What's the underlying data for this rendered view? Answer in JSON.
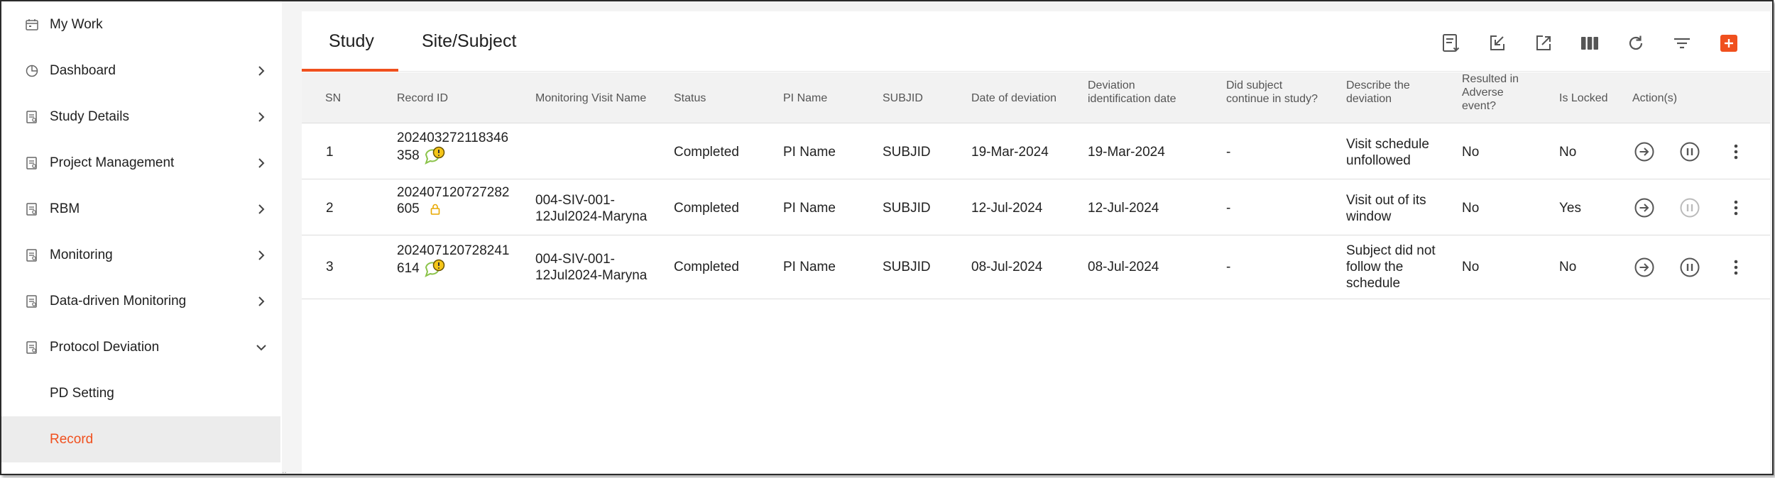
{
  "sidebar": {
    "items": [
      {
        "label": "My Work",
        "icon": "calendar-icon",
        "chevron": "none"
      },
      {
        "label": "Dashboard",
        "icon": "pie-chart-icon",
        "chevron": "right"
      },
      {
        "label": "Study Details",
        "icon": "document-icon",
        "chevron": "right"
      },
      {
        "label": "Project Management",
        "icon": "document-icon",
        "chevron": "right"
      },
      {
        "label": "RBM",
        "icon": "document-icon",
        "chevron": "right"
      },
      {
        "label": "Monitoring",
        "icon": "document-icon",
        "chevron": "right"
      },
      {
        "label": "Data-driven Monitoring",
        "icon": "document-icon",
        "chevron": "right"
      },
      {
        "label": "Protocol Deviation",
        "icon": "document-icon",
        "chevron": "down"
      }
    ],
    "subitems": [
      {
        "label": "PD Setting",
        "active": false
      },
      {
        "label": "Record",
        "active": true
      }
    ]
  },
  "tabs": [
    {
      "label": "Study",
      "active": true
    },
    {
      "label": "Site/Subject",
      "active": false
    }
  ],
  "toolbar": {
    "icons": [
      "export-report-icon",
      "import-icon",
      "open-external-icon",
      "columns-icon",
      "refresh-icon",
      "filter-icon",
      "add-icon"
    ]
  },
  "table": {
    "headers": [
      "SN",
      "Record ID",
      "Monitoring Visit Name",
      "Status",
      "PI Name",
      "SUBJID",
      "Date of deviation",
      "Deviation identification date",
      "Did subject continue in study?",
      "Describe the deviation",
      "Resulted in Adverse event?",
      "Is Locked",
      "Action(s)"
    ],
    "rows": [
      {
        "sn": "1",
        "record_id_line1": "202403272118346",
        "record_id_line2": "358",
        "record_icon": "comment-alert-icon",
        "visit_line1": "",
        "visit_line2": "",
        "status": "Completed",
        "pi_name": "PI Name",
        "subjid": "SUBJID",
        "date_deviation": "19-Mar-2024",
        "date_identification": "19-Mar-2024",
        "continue": "-",
        "describe": "Visit schedule unfollowed",
        "adverse": "No",
        "locked": "No"
      },
      {
        "sn": "2",
        "record_id_line1": "202407120727282",
        "record_id_line2": "605",
        "record_icon": "lock-icon",
        "visit_line1": "004-SIV-001-",
        "visit_line2": "12Jul2024-Maryna",
        "status": "Completed",
        "pi_name": "PI Name",
        "subjid": "SUBJID",
        "date_deviation": "12-Jul-2024",
        "date_identification": "12-Jul-2024",
        "continue": "-",
        "describe": "Visit out of its window",
        "adverse": "No",
        "locked": "Yes"
      },
      {
        "sn": "3",
        "record_id_line1": "202407120728241",
        "record_id_line2": "614",
        "record_icon": "comment-alert-icon",
        "visit_line1": "004-SIV-001-",
        "visit_line2": "12Jul2024-Maryna",
        "status": "Completed",
        "pi_name": "PI Name",
        "subjid": "SUBJID",
        "date_deviation": "08-Jul-2024",
        "date_identification": "08-Jul-2024",
        "continue": "-",
        "describe": "Subject did not follow the schedule",
        "adverse": "No",
        "locked": "No"
      }
    ]
  },
  "colors": {
    "accent": "#f0501e",
    "header_bg": "#f2f2f2",
    "active_nav_bg": "#ececec",
    "lock_icon": "#e8a800",
    "comment_icon": "#8bc34a",
    "alert_icon": "#f5c518"
  }
}
